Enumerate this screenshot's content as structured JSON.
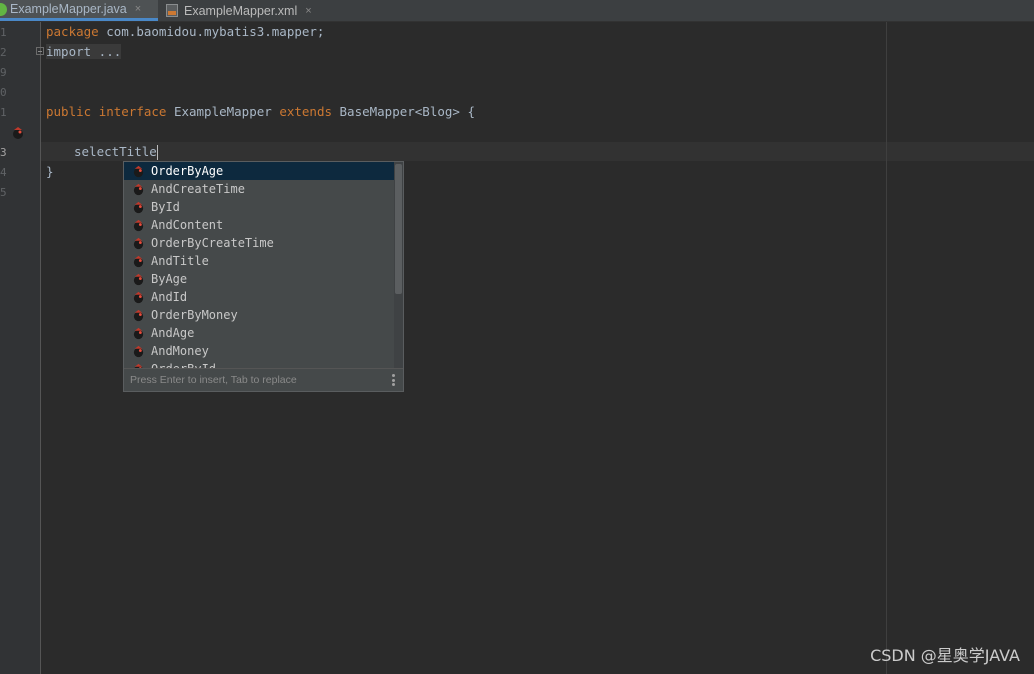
{
  "tabs": [
    {
      "label": "ExampleMapper.java",
      "icon": "java-class-icon",
      "active": true
    },
    {
      "label": "ExampleMapper.xml",
      "icon": "xml-file-icon",
      "active": false
    }
  ],
  "tab_close": "×",
  "line_numbers": [
    "1",
    "2",
    "9",
    "0",
    "1",
    "3",
    "4",
    "5"
  ],
  "code": {
    "line1_kw": "package",
    "line1_rest": " com.baomidou.mybatis3.mapper;",
    "line2_fold": "import ...",
    "line4_kw1": "public",
    "line4_kw2": "interface",
    "line4_name": " ExampleMapper ",
    "line4_kw3": "extends",
    "line4_rest": " BaseMapper<Blog> {",
    "line6_text": "selectTitle",
    "line7_text": "}"
  },
  "completion": {
    "items": [
      "OrderByAge",
      "AndCreateTime",
      "ById",
      "AndContent",
      "OrderByCreateTime",
      "AndTitle",
      "ByAge",
      "AndId",
      "OrderByMoney",
      "AndAge",
      "AndMoney",
      "OrderById"
    ],
    "selected_index": 0,
    "hint": "Press Enter to insert, Tab to replace"
  },
  "watermark": "CSDN @星奥学JAVA",
  "colors": {
    "background": "#2b2b2b",
    "keyword": "#cc7832",
    "text": "#a9b7c6",
    "selection": "#0d293e"
  }
}
